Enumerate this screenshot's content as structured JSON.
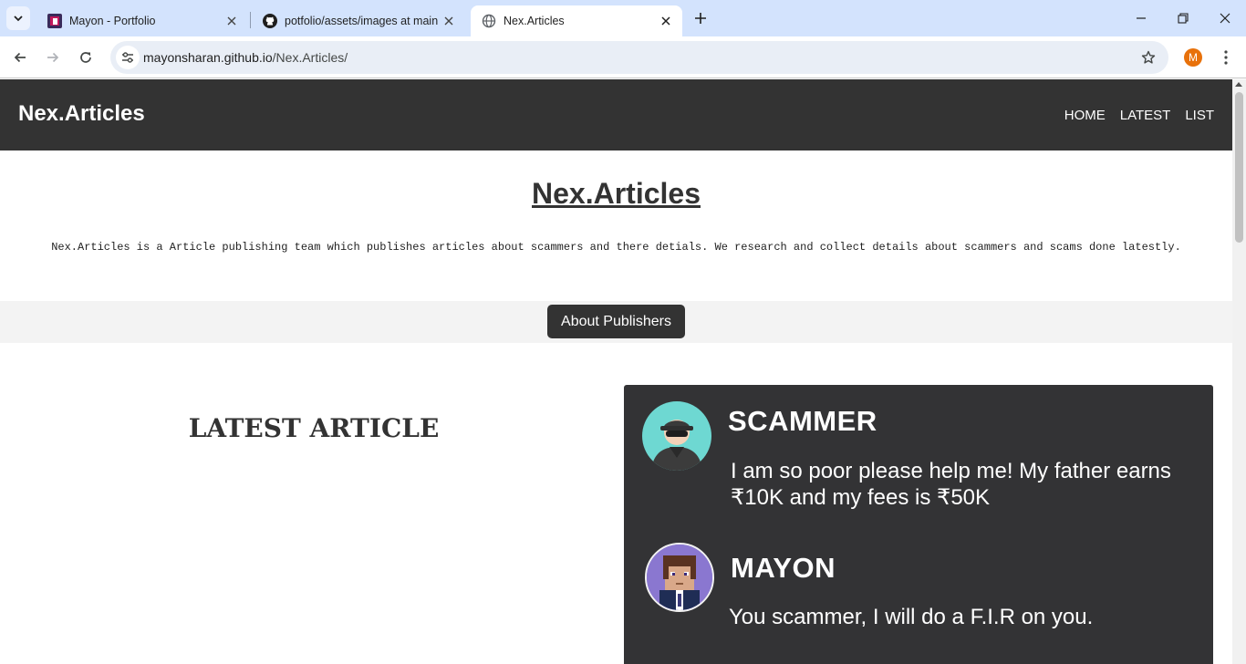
{
  "browser": {
    "tabs": [
      {
        "title": "Mayon - Portfolio",
        "active": false,
        "favicon": "portfolio-favicon"
      },
      {
        "title": "potfolio/assets/images at main",
        "active": false,
        "favicon": "github-icon"
      },
      {
        "title": "Nex.Articles",
        "active": true,
        "favicon": "globe-icon"
      }
    ],
    "url_host": "mayonsharan.github.io",
    "url_path": "/Nex.Articles/",
    "profile_initial": "M"
  },
  "site": {
    "brand": "Nex.Articles",
    "nav": [
      "HOME",
      "LATEST",
      "LIST"
    ],
    "hero_title": "Nex.Articles",
    "hero_description": "Nex.Articles is a Article publishing team which publishes articles about scammers and there detials. We research and collect details about scammers and scams done latestly.",
    "publishers_button": "About Publishers",
    "latest_heading": "LATEST ARTICLE"
  },
  "article_image": {
    "messages": [
      {
        "name": "SCAMMER",
        "text": "I am so poor please help me! My father earns ₹10K and my fees is ₹50K"
      },
      {
        "name": "MAYON",
        "text": "You scammer, I will do a F.I.R on you."
      }
    ]
  },
  "colors": {
    "tabstrip": "#d3e3fd",
    "header": "#333333",
    "card": "#333335",
    "profile": "#e8710a"
  }
}
